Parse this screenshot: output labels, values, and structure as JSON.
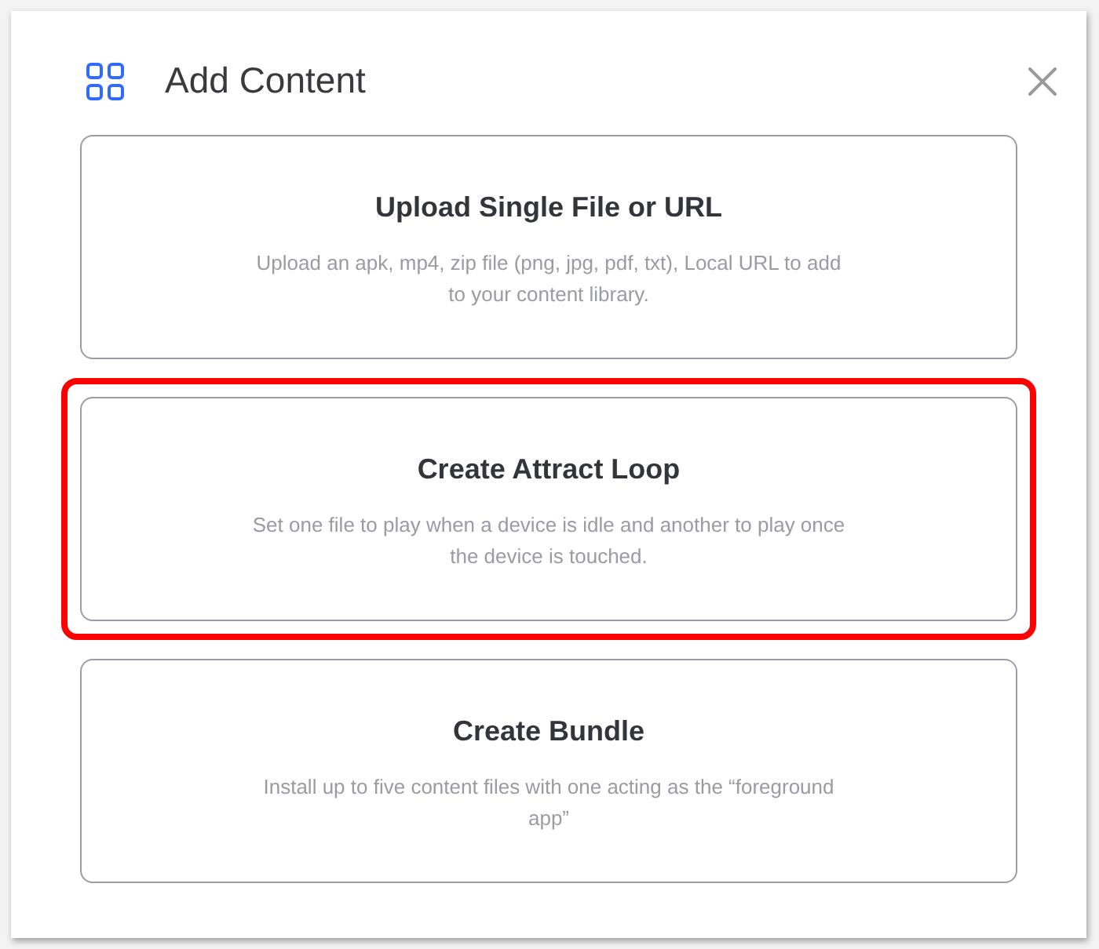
{
  "dialog": {
    "title": "Add Content",
    "options": [
      {
        "title": "Upload Single File or URL",
        "description": "Upload an apk, mp4, zip file (png, jpg, pdf, txt), Local URL to add to your content library.",
        "highlighted": false
      },
      {
        "title": "Create Attract Loop",
        "description": "Set one file to play when a device is idle and another to play once the device is touched.",
        "highlighted": true
      },
      {
        "title": "Create Bundle",
        "description": "Install up to five content files with one acting as the “foreground app”",
        "highlighted": false
      }
    ]
  }
}
